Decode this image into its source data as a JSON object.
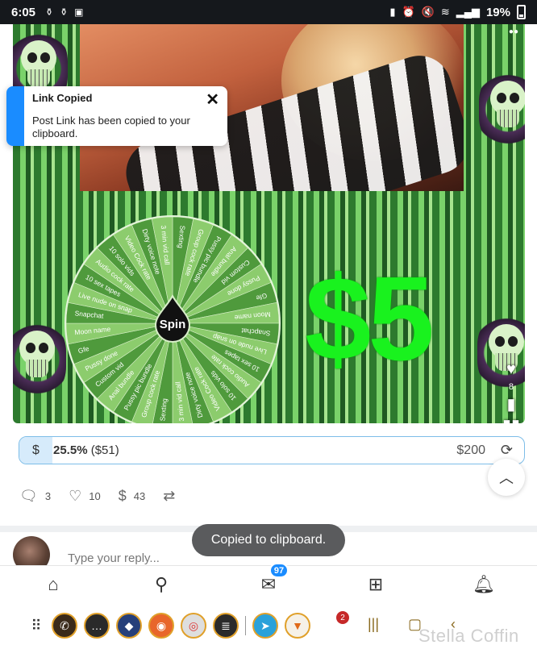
{
  "status_bar": {
    "time": "6:05",
    "battery": "19%",
    "icons": [
      "notification-icon",
      "notification-icon",
      "image-icon",
      "sim-icon",
      "alarm-icon",
      "mute-icon",
      "wifi-icon",
      "signal-icon"
    ]
  },
  "toast": {
    "title": "Link Copied",
    "message": "Post Link has been copied to your clipboard.",
    "close_glyph": "✕",
    "accent": "#1a8cff"
  },
  "media": {
    "price_text": "$5",
    "wheel_center_label": "Spin",
    "wheel_segments": [
      "Sexting",
      "Group cock rate",
      "Pussy pic bundle",
      "Anal bundle",
      "Custom vid",
      "Pussy done",
      "Gfe",
      "Moon name",
      "Snapchat",
      "Live nude on snap",
      "10 sex tapes",
      "Audio cock rate",
      "10 solo vids",
      "Video Cock rate",
      "Dirty voice note",
      "3 min vid call",
      "Sexting",
      "Group cock rate",
      "Pussy pic bundle",
      "Anal bundle",
      "Custom vid",
      "Pussy done",
      "Gfe",
      "Moon name",
      "Snapchat",
      "Live nude on snap",
      "10 sex tapes",
      "Audio cock rate",
      "10 solo vids",
      "Video Cock rate",
      "Dirty voice note",
      "3 min vid call"
    ],
    "side_actions": {
      "like_count": "8"
    }
  },
  "tip_goal": {
    "currency_glyph": "$",
    "percent": "25.5%",
    "raised": "($51)",
    "progress": 0.255,
    "target": "$200",
    "refresh_glyph": "⟳"
  },
  "stats": {
    "comments": "3",
    "likes": "10",
    "tips": "43"
  },
  "reply": {
    "placeholder": "Type your reply..."
  },
  "snackbar": {
    "text": "Copied to clipboard."
  },
  "bottom_nav": {
    "messages_badge": "97"
  },
  "dock": {
    "notification_badge": "2",
    "watermark": "Stella Coffin"
  }
}
